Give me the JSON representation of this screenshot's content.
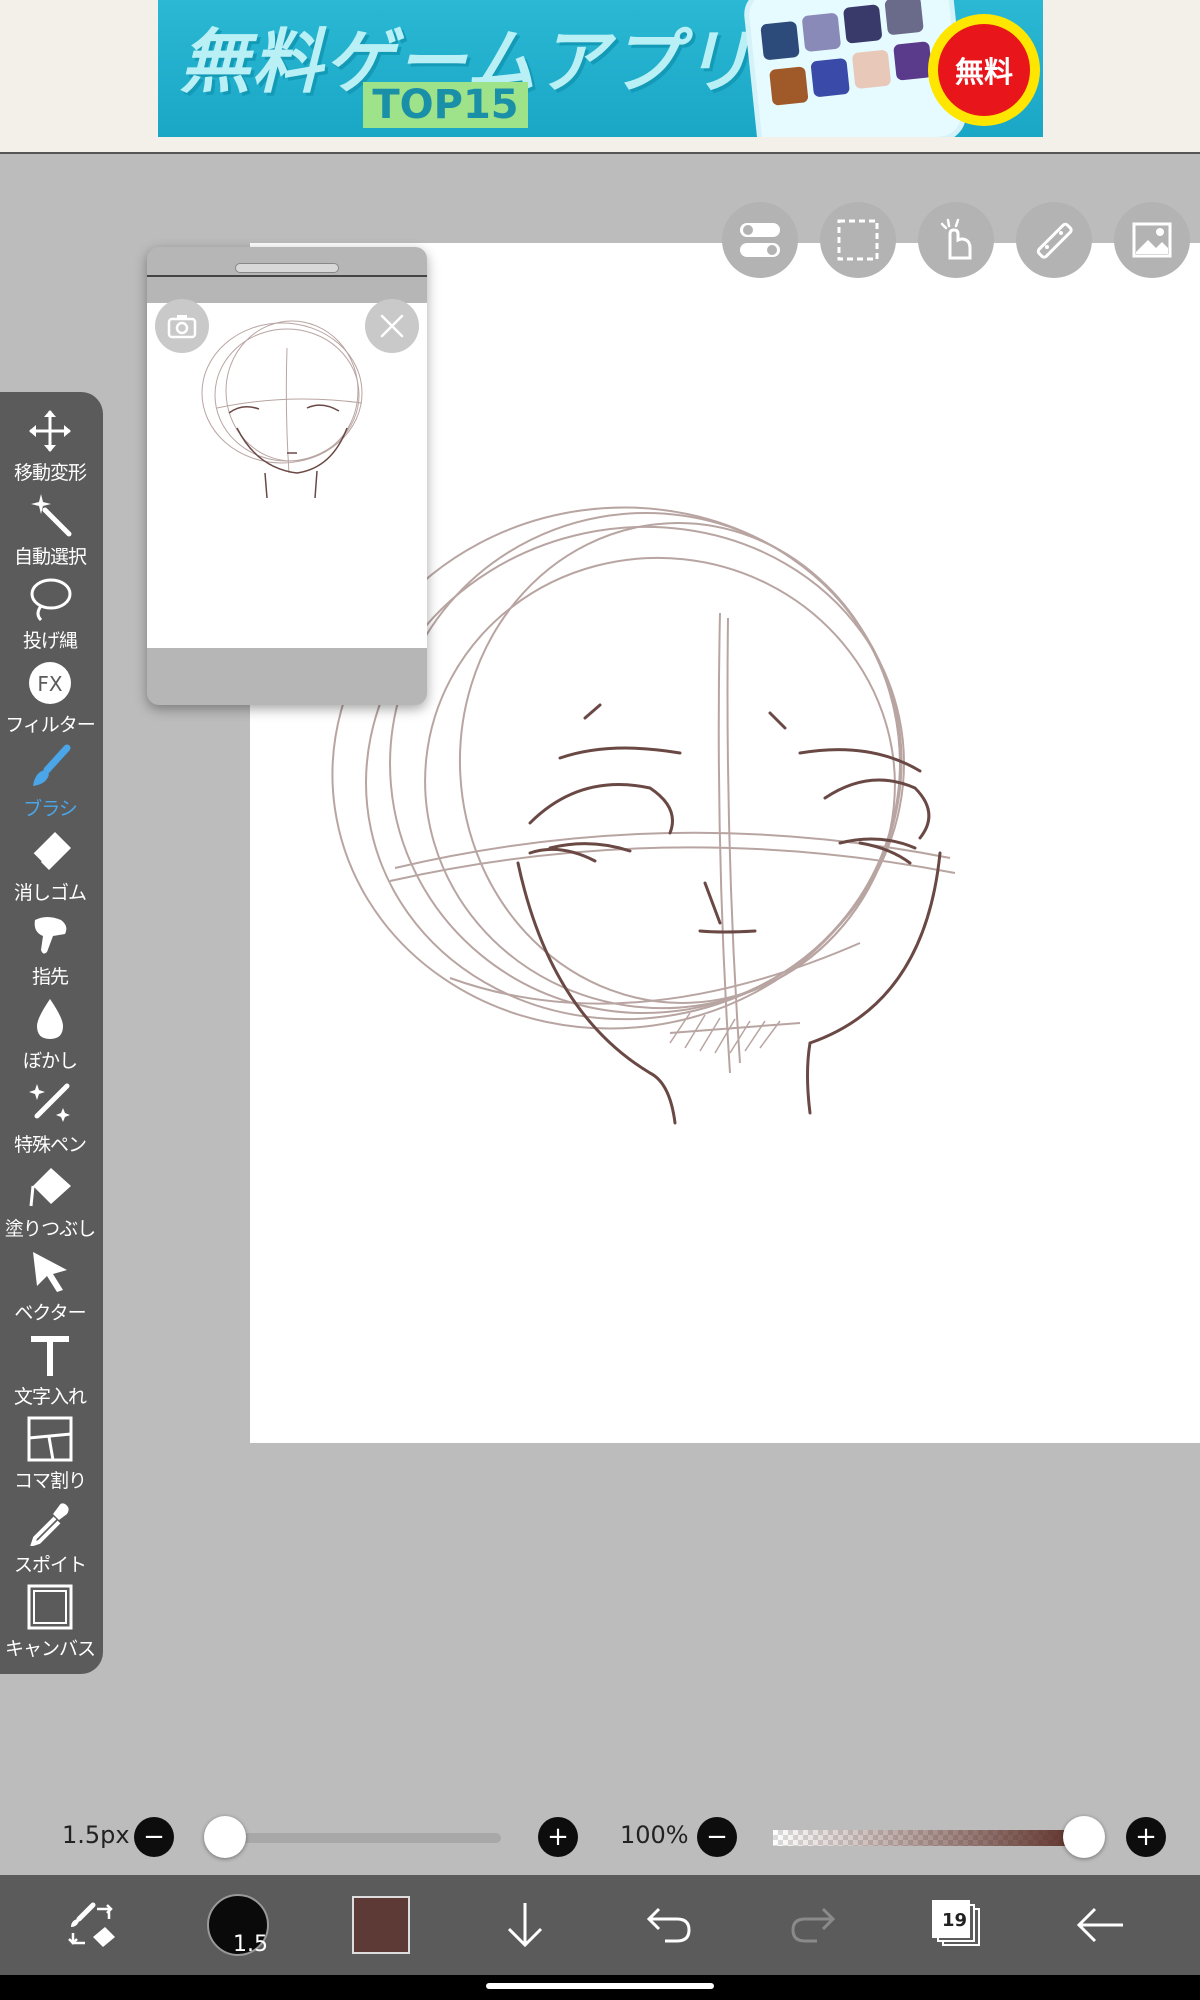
{
  "ad": {
    "title": "無料ゲームアプリ",
    "subtitle": "TOP15",
    "badge": "無料"
  },
  "top_buttons": [
    {
      "name": "toggle-icon"
    },
    {
      "name": "selection-icon"
    },
    {
      "name": "hand-icon"
    },
    {
      "name": "ruler-icon"
    },
    {
      "name": "material-icon"
    }
  ],
  "toolbar": {
    "items": [
      {
        "label": "移動変形",
        "icon": "move-icon"
      },
      {
        "label": "自動選択",
        "icon": "magic-wand-icon"
      },
      {
        "label": "投げ縄",
        "icon": "lasso-icon"
      },
      {
        "label": "フィルター",
        "icon": "fx-icon"
      },
      {
        "label": "ブラシ",
        "icon": "brush-icon"
      },
      {
        "label": "消しゴム",
        "icon": "eraser-icon"
      },
      {
        "label": "指先",
        "icon": "finger-icon"
      },
      {
        "label": "ぼかし",
        "icon": "drop-icon"
      },
      {
        "label": "特殊ペン",
        "icon": "sparkle-pen-icon"
      },
      {
        "label": "塗りつぶし",
        "icon": "bucket-icon"
      },
      {
        "label": "ベクター",
        "icon": "vector-arrow-icon"
      },
      {
        "label": "文字入れ",
        "icon": "text-icon"
      },
      {
        "label": "コマ割り",
        "icon": "panel-icon"
      },
      {
        "label": "スポイト",
        "icon": "eyedropper-icon"
      },
      {
        "label": "キャンバス",
        "icon": "canvas-icon"
      }
    ],
    "active": "ブラシ",
    "accent_color": "#4aa6e8"
  },
  "brush": {
    "size_label": "1.5px",
    "size_value": "1.5",
    "opacity_label": "100%",
    "color": "#5d3a35"
  },
  "layers": {
    "count": "19"
  }
}
